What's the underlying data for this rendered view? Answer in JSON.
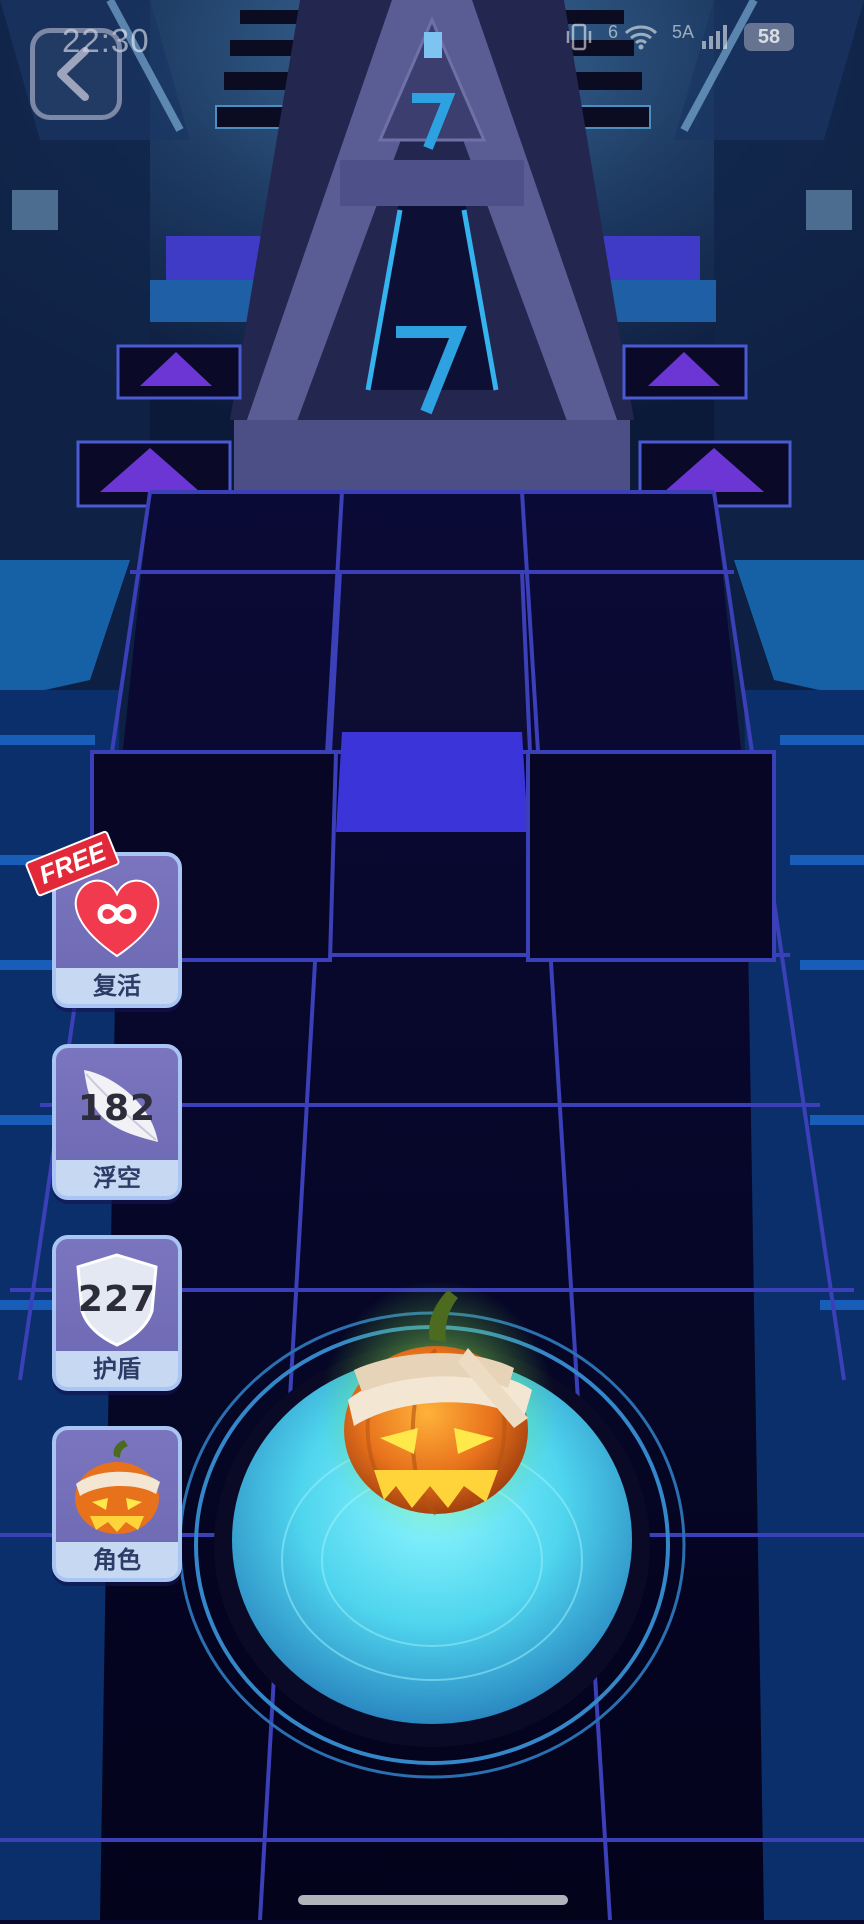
{
  "status_bar": {
    "time": "22:30",
    "network": "5A",
    "battery": "58",
    "signal_suffix": "6"
  },
  "game": {
    "player_character": "jack-o-lantern-mummy",
    "colors": {
      "tile_dark": "#07062a",
      "tile_grid": "#3b3fb8",
      "tile_highlight": "#3a34d9",
      "platform": "#4b4f86",
      "glow": "#62e3f1",
      "button_bg": "#7a75be",
      "button_label_bg": "#c7d8f3"
    }
  },
  "powerups": [
    {
      "label": "复活",
      "icon": "infinity-heart-icon",
      "badge": "FREE"
    },
    {
      "label": "浮空",
      "icon": "feather-icon",
      "count": "182"
    },
    {
      "label": "护盾",
      "icon": "shield-icon",
      "count": "227"
    },
    {
      "label": "角色",
      "icon": "pumpkin-character-icon"
    }
  ]
}
